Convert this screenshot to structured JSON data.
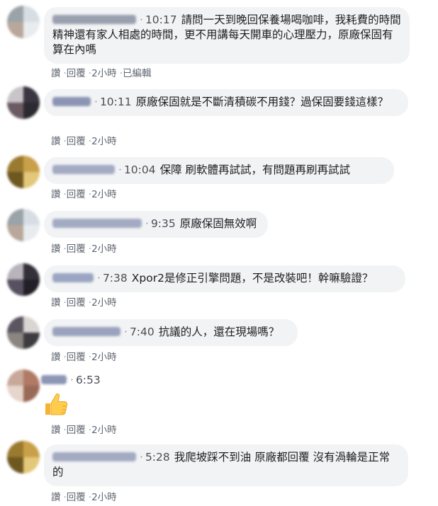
{
  "actions": {
    "like": "讚",
    "reply": "回覆",
    "edited": "已編輯"
  },
  "comments": [
    {
      "time": "10:17",
      "text": "請問一天到晚回保養場喝咖啡，我耗費的時間精神還有家人相處的時間，更不用講每天開車的心理壓力，原廠保固有算在內嗎",
      "ago": "2小時",
      "edited": true
    },
    {
      "time": "10:11",
      "text": "原廠保固就是不斷清積碳不用錢？過保固要錢這樣？",
      "ago": "2小時"
    },
    {
      "time": "10:04",
      "text": "保障 刷軟體再試試，有問題再刷再試試",
      "ago": "2小時"
    },
    {
      "time": "9:35",
      "text": "原廠保固無效啊",
      "ago": "2小時"
    },
    {
      "time": "7:38",
      "text": "Xpor2是修正引擎問題，不是改裝吧！幹嘛驗證？",
      "ago": "2小時"
    },
    {
      "time": "7:40",
      "text": "抗議的人，還在現場嗎？",
      "ago": "2小時"
    },
    {
      "time": "6:53",
      "text": "",
      "ago": "2小時",
      "sticker": "thumbs-up"
    },
    {
      "time": "5:28",
      "text": "我爬坡踩不到油 原廠都回覆 沒有渦輪是正常的",
      "ago": "2小時"
    }
  ],
  "colors": {
    "bubble": "#f2f3f5",
    "action_text": "#606770",
    "time_text": "#4b4f56"
  }
}
